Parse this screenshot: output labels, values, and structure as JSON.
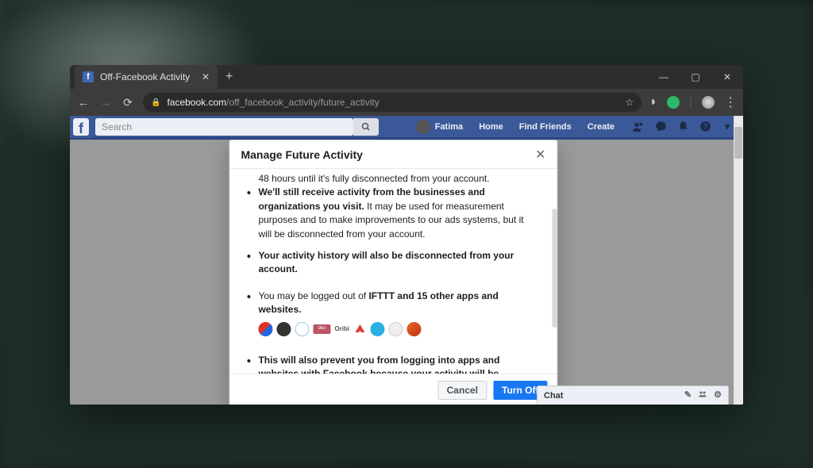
{
  "browser": {
    "tab_title": "Off-Facebook Activity",
    "url_domain": "facebook.com",
    "url_path": "/off_facebook_activity/future_activity"
  },
  "fb_header": {
    "search_placeholder": "Search",
    "profile_name": "Fatima",
    "links": {
      "home": "Home",
      "find_friends": "Find Friends",
      "create": "Create"
    }
  },
  "modal": {
    "title": "Manage Future Activity",
    "truncated_line": "48 hours until it's fully disconnected from your account.",
    "bullet2_strong": "We'll still receive activity from the businesses and organizations you visit.",
    "bullet2_rest": " It may be used for measurement purposes and to make improvements to our ads systems, but it will be disconnected from your account.",
    "bullet3": "Your activity history will also be disconnected from your account.",
    "bullet4_pre": "You may be logged out of ",
    "bullet4_strong": "IFTTT and 15 other apps and websites.",
    "bullet5_strong": "This will also prevent you from logging into apps and websites with Facebook because your activity will be disconnected ",
    "app_icons": [
      "#2962d6",
      "#333333",
      "#5aa0e0",
      "#c56d2e",
      "#555555",
      "#e03a3a",
      "#2ab0e0",
      "#666666",
      "#d06c2c"
    ],
    "oribi_label": "Oribi",
    "cancel_label": "Cancel",
    "confirm_label": "Turn Off"
  },
  "chat": {
    "label": "Chat"
  }
}
